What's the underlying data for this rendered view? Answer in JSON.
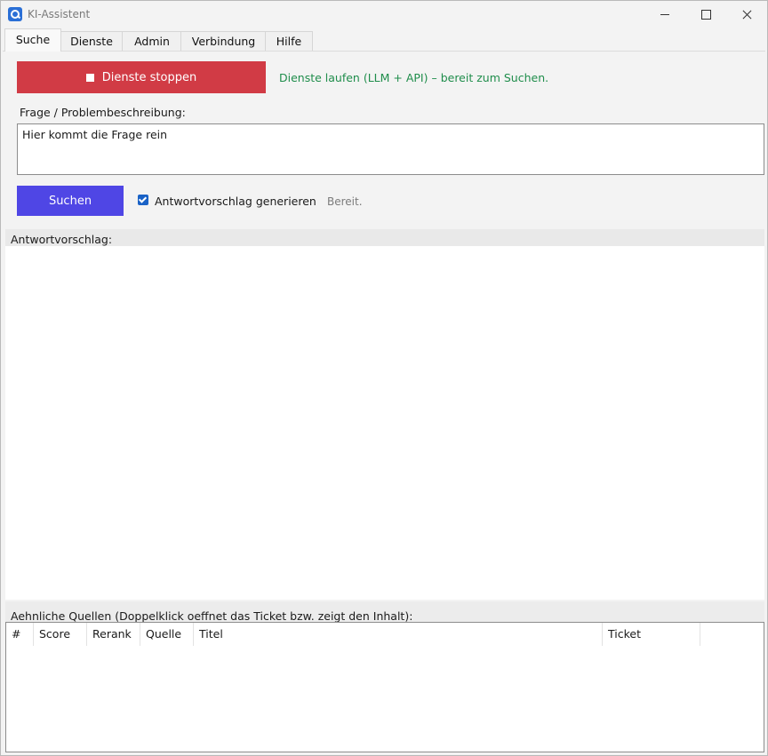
{
  "window": {
    "title": "KI-Assistent"
  },
  "tabs": [
    "Suche",
    "Dienste",
    "Admin",
    "Verbindung",
    "Hilfe"
  ],
  "service": {
    "stop_label": "Dienste stoppen",
    "status": "Dienste laufen (LLM + API) – bereit zum Suchen."
  },
  "question": {
    "label": "Frage / Problembeschreibung:",
    "value": "Hier kommt die Frage rein"
  },
  "search": {
    "button_label": "Suchen",
    "checkbox_label": "Antwortvorschlag generieren",
    "checkbox_checked": true,
    "status": "Bereit."
  },
  "answer": {
    "label": "Antwortvorschlag:"
  },
  "sources": {
    "label": "Aehnliche Quellen (Doppelklick oeffnet das Ticket bzw. zeigt den Inhalt):",
    "columns": [
      "#",
      "Score",
      "Rerank",
      "Quelle",
      "Titel",
      "Ticket",
      ""
    ],
    "rows": []
  },
  "colors": {
    "stop_button": "#d13b45",
    "search_button": "#4f46e5",
    "status_ok": "#1f8d4b",
    "checkbox": "#1a62c6"
  }
}
